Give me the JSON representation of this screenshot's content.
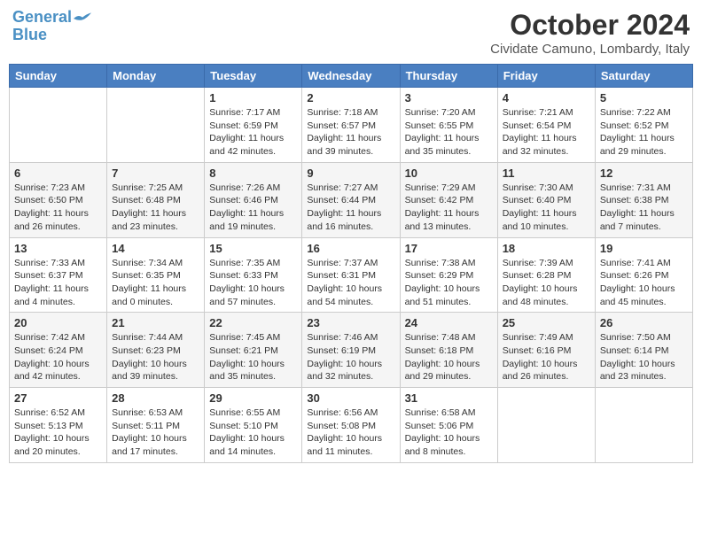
{
  "header": {
    "logo_line1": "General",
    "logo_line2": "Blue",
    "month": "October 2024",
    "location": "Cividate Camuno, Lombardy, Italy"
  },
  "weekdays": [
    "Sunday",
    "Monday",
    "Tuesday",
    "Wednesday",
    "Thursday",
    "Friday",
    "Saturday"
  ],
  "weeks": [
    [
      {
        "day": "",
        "sunrise": "",
        "sunset": "",
        "daylight": ""
      },
      {
        "day": "",
        "sunrise": "",
        "sunset": "",
        "daylight": ""
      },
      {
        "day": "1",
        "sunrise": "Sunrise: 7:17 AM",
        "sunset": "Sunset: 6:59 PM",
        "daylight": "Daylight: 11 hours and 42 minutes."
      },
      {
        "day": "2",
        "sunrise": "Sunrise: 7:18 AM",
        "sunset": "Sunset: 6:57 PM",
        "daylight": "Daylight: 11 hours and 39 minutes."
      },
      {
        "day": "3",
        "sunrise": "Sunrise: 7:20 AM",
        "sunset": "Sunset: 6:55 PM",
        "daylight": "Daylight: 11 hours and 35 minutes."
      },
      {
        "day": "4",
        "sunrise": "Sunrise: 7:21 AM",
        "sunset": "Sunset: 6:54 PM",
        "daylight": "Daylight: 11 hours and 32 minutes."
      },
      {
        "day": "5",
        "sunrise": "Sunrise: 7:22 AM",
        "sunset": "Sunset: 6:52 PM",
        "daylight": "Daylight: 11 hours and 29 minutes."
      }
    ],
    [
      {
        "day": "6",
        "sunrise": "Sunrise: 7:23 AM",
        "sunset": "Sunset: 6:50 PM",
        "daylight": "Daylight: 11 hours and 26 minutes."
      },
      {
        "day": "7",
        "sunrise": "Sunrise: 7:25 AM",
        "sunset": "Sunset: 6:48 PM",
        "daylight": "Daylight: 11 hours and 23 minutes."
      },
      {
        "day": "8",
        "sunrise": "Sunrise: 7:26 AM",
        "sunset": "Sunset: 6:46 PM",
        "daylight": "Daylight: 11 hours and 19 minutes."
      },
      {
        "day": "9",
        "sunrise": "Sunrise: 7:27 AM",
        "sunset": "Sunset: 6:44 PM",
        "daylight": "Daylight: 11 hours and 16 minutes."
      },
      {
        "day": "10",
        "sunrise": "Sunrise: 7:29 AM",
        "sunset": "Sunset: 6:42 PM",
        "daylight": "Daylight: 11 hours and 13 minutes."
      },
      {
        "day": "11",
        "sunrise": "Sunrise: 7:30 AM",
        "sunset": "Sunset: 6:40 PM",
        "daylight": "Daylight: 11 hours and 10 minutes."
      },
      {
        "day": "12",
        "sunrise": "Sunrise: 7:31 AM",
        "sunset": "Sunset: 6:38 PM",
        "daylight": "Daylight: 11 hours and 7 minutes."
      }
    ],
    [
      {
        "day": "13",
        "sunrise": "Sunrise: 7:33 AM",
        "sunset": "Sunset: 6:37 PM",
        "daylight": "Daylight: 11 hours and 4 minutes."
      },
      {
        "day": "14",
        "sunrise": "Sunrise: 7:34 AM",
        "sunset": "Sunset: 6:35 PM",
        "daylight": "Daylight: 11 hours and 0 minutes."
      },
      {
        "day": "15",
        "sunrise": "Sunrise: 7:35 AM",
        "sunset": "Sunset: 6:33 PM",
        "daylight": "Daylight: 10 hours and 57 minutes."
      },
      {
        "day": "16",
        "sunrise": "Sunrise: 7:37 AM",
        "sunset": "Sunset: 6:31 PM",
        "daylight": "Daylight: 10 hours and 54 minutes."
      },
      {
        "day": "17",
        "sunrise": "Sunrise: 7:38 AM",
        "sunset": "Sunset: 6:29 PM",
        "daylight": "Daylight: 10 hours and 51 minutes."
      },
      {
        "day": "18",
        "sunrise": "Sunrise: 7:39 AM",
        "sunset": "Sunset: 6:28 PM",
        "daylight": "Daylight: 10 hours and 48 minutes."
      },
      {
        "day": "19",
        "sunrise": "Sunrise: 7:41 AM",
        "sunset": "Sunset: 6:26 PM",
        "daylight": "Daylight: 10 hours and 45 minutes."
      }
    ],
    [
      {
        "day": "20",
        "sunrise": "Sunrise: 7:42 AM",
        "sunset": "Sunset: 6:24 PM",
        "daylight": "Daylight: 10 hours and 42 minutes."
      },
      {
        "day": "21",
        "sunrise": "Sunrise: 7:44 AM",
        "sunset": "Sunset: 6:23 PM",
        "daylight": "Daylight: 10 hours and 39 minutes."
      },
      {
        "day": "22",
        "sunrise": "Sunrise: 7:45 AM",
        "sunset": "Sunset: 6:21 PM",
        "daylight": "Daylight: 10 hours and 35 minutes."
      },
      {
        "day": "23",
        "sunrise": "Sunrise: 7:46 AM",
        "sunset": "Sunset: 6:19 PM",
        "daylight": "Daylight: 10 hours and 32 minutes."
      },
      {
        "day": "24",
        "sunrise": "Sunrise: 7:48 AM",
        "sunset": "Sunset: 6:18 PM",
        "daylight": "Daylight: 10 hours and 29 minutes."
      },
      {
        "day": "25",
        "sunrise": "Sunrise: 7:49 AM",
        "sunset": "Sunset: 6:16 PM",
        "daylight": "Daylight: 10 hours and 26 minutes."
      },
      {
        "day": "26",
        "sunrise": "Sunrise: 7:50 AM",
        "sunset": "Sunset: 6:14 PM",
        "daylight": "Daylight: 10 hours and 23 minutes."
      }
    ],
    [
      {
        "day": "27",
        "sunrise": "Sunrise: 6:52 AM",
        "sunset": "Sunset: 5:13 PM",
        "daylight": "Daylight: 10 hours and 20 minutes."
      },
      {
        "day": "28",
        "sunrise": "Sunrise: 6:53 AM",
        "sunset": "Sunset: 5:11 PM",
        "daylight": "Daylight: 10 hours and 17 minutes."
      },
      {
        "day": "29",
        "sunrise": "Sunrise: 6:55 AM",
        "sunset": "Sunset: 5:10 PM",
        "daylight": "Daylight: 10 hours and 14 minutes."
      },
      {
        "day": "30",
        "sunrise": "Sunrise: 6:56 AM",
        "sunset": "Sunset: 5:08 PM",
        "daylight": "Daylight: 10 hours and 11 minutes."
      },
      {
        "day": "31",
        "sunrise": "Sunrise: 6:58 AM",
        "sunset": "Sunset: 5:06 PM",
        "daylight": "Daylight: 10 hours and 8 minutes."
      },
      {
        "day": "",
        "sunrise": "",
        "sunset": "",
        "daylight": ""
      },
      {
        "day": "",
        "sunrise": "",
        "sunset": "",
        "daylight": ""
      }
    ]
  ]
}
